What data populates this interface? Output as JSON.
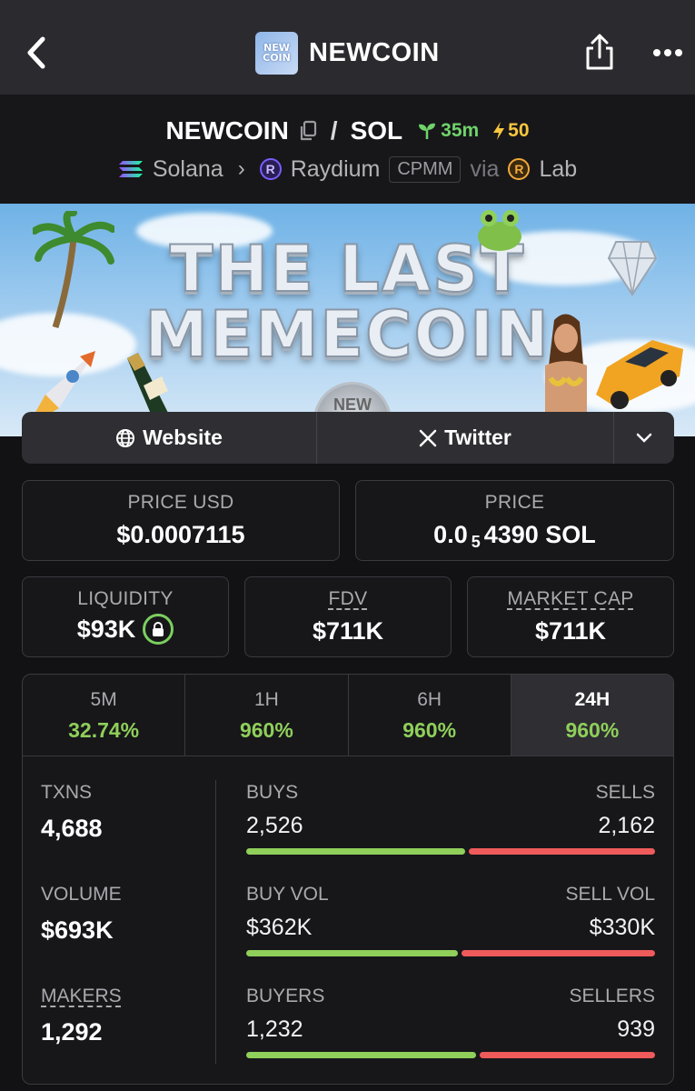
{
  "header": {
    "title": "NEWCOIN",
    "logo_text_line1": "NEW",
    "logo_text_line2": "COIN"
  },
  "pair": {
    "base": "NEWCOIN",
    "separator": "/",
    "quote": "SOL",
    "age": "35m",
    "boosts": "50",
    "chain": "Solana",
    "dex": "Raydium",
    "pool_type": "CPMM",
    "via_label": "via",
    "source": "Lab"
  },
  "banner": {
    "line1": "THE LAST",
    "line2": "MEMECOIN",
    "coin_text": "NEW"
  },
  "links": {
    "website": "Website",
    "twitter": "Twitter"
  },
  "stats": {
    "price_usd_label": "PRICE USD",
    "price_usd": "$0.0007115",
    "price_label": "PRICE",
    "price_prefix": "0.0",
    "price_zeros": "5",
    "price_suffix": "4390 SOL",
    "liquidity_label": "LIQUIDITY",
    "liquidity": "$93K",
    "fdv_label": "FDV",
    "fdv": "$711K",
    "mcap_label": "MARKET CAP",
    "mcap": "$711K"
  },
  "timeframes": [
    {
      "label": "5M",
      "change": "32.74%"
    },
    {
      "label": "1H",
      "change": "960%"
    },
    {
      "label": "6H",
      "change": "960%"
    },
    {
      "label": "24H",
      "change": "960%"
    }
  ],
  "metrics": {
    "txns_label": "TXNS",
    "txns": "4,688",
    "volume_label": "VOLUME",
    "volume": "$693K",
    "makers_label": "MAKERS",
    "makers": "1,292",
    "buys_label": "BUYS",
    "buys": "2,526",
    "sells_label": "SELLS",
    "sells": "2,162",
    "buys_fraction": 0.539,
    "buyvol_label": "BUY VOL",
    "buyvol": "$362K",
    "sellvol_label": "SELL VOL",
    "sellvol": "$330K",
    "buyvol_fraction": 0.523,
    "buyers_label": "BUYERS",
    "buyers": "1,232",
    "sellers_label": "SELLERS",
    "sellers": "939",
    "buyers_fraction": 0.567
  },
  "colors": {
    "positive": "#8fcf5a",
    "negative": "#ef5a5a",
    "age_green": "#6fd36a",
    "boost_yellow": "#f7c63d"
  }
}
